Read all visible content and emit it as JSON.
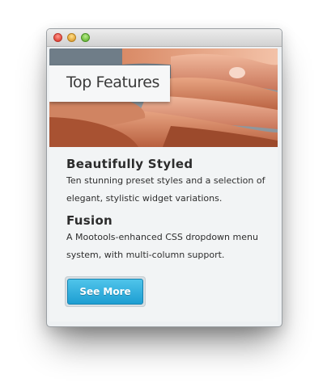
{
  "hero": {
    "label": "Top Features"
  },
  "features": [
    {
      "title": "Beautifully Styled",
      "description": "Ten stunning preset styles and a selection of elegant, stylistic widget variations."
    },
    {
      "title": "Fusion",
      "description": "A Mootools-enhanced CSS dropdown menu system, with multi-column support."
    }
  ],
  "button": {
    "label": "See More"
  },
  "colors": {
    "button": "#1e9ed2",
    "panel": "#f2f4f5",
    "close": "#e2483c",
    "minimize": "#e2a53a",
    "zoom": "#6ebd3e"
  }
}
